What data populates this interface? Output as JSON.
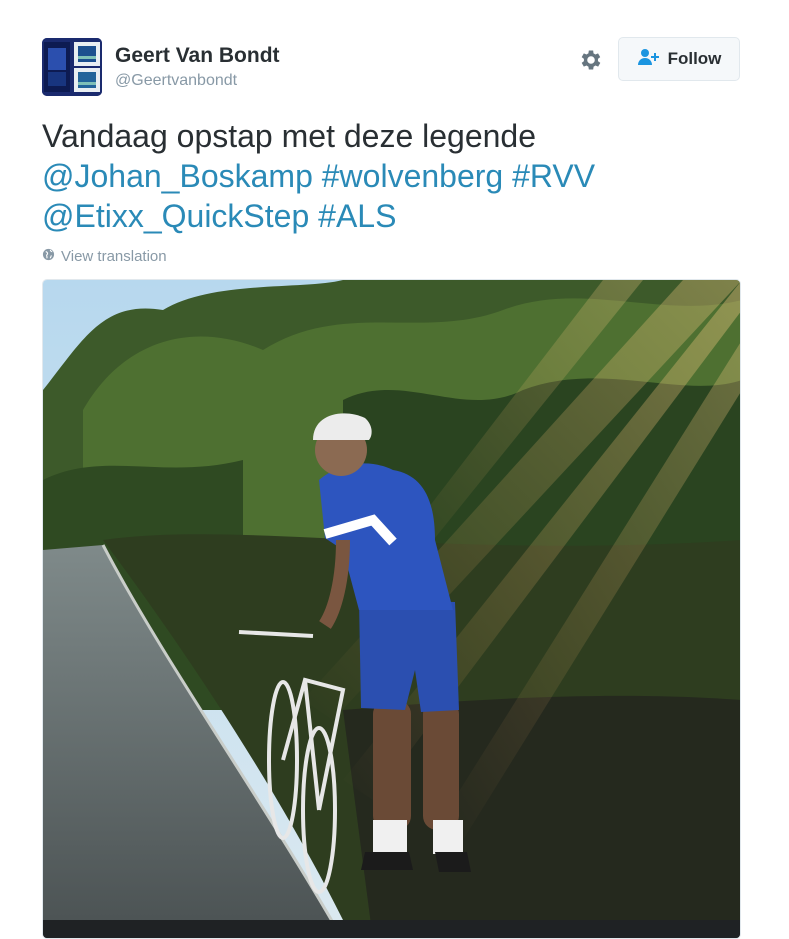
{
  "tweet": {
    "author_name": "Geert Van Bondt",
    "author_handle": "@Geertvanbondt",
    "text_plain": "Vandaag opstap met deze legende",
    "mention_1": "@Johan_Boskamp",
    "hashtag_1": "#wolvenberg",
    "hashtag_2": "#RVV",
    "mention_2": "@Etixx_QuickStep",
    "hashtag_3": "#ALS",
    "translate_label": "View translation"
  },
  "actions": {
    "follow_label": "Follow",
    "settings_icon": "gear-icon",
    "follow_icon": "add-user-icon"
  },
  "colors": {
    "link": "#2a8ab7",
    "muted": "#8899a6",
    "text": "#292f33"
  }
}
